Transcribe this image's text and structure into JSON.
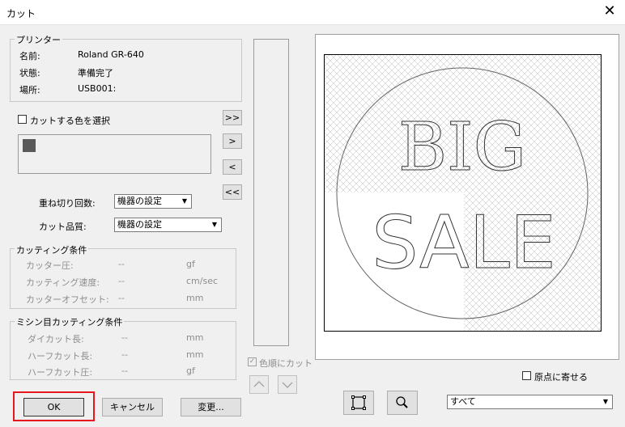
{
  "window": {
    "title": "カット",
    "close": "✕"
  },
  "printer": {
    "legend": "プリンター",
    "rows": [
      {
        "label": "名前:",
        "value": "Roland GR-640"
      },
      {
        "label": "状態:",
        "value": "準備完了"
      },
      {
        "label": "場所:",
        "value": "USB001:"
      }
    ]
  },
  "color_select": {
    "label": "カットする色を選択",
    "checked": false,
    "swatch": "#595959"
  },
  "move_buttons": [
    ">>",
    ">",
    "<",
    "<<"
  ],
  "settings": {
    "passes_label": "重ね切り回数:",
    "passes_value": "機器の設定",
    "quality_label": "カット品質:",
    "quality_value": "機器の設定"
  },
  "cutting": {
    "legend": "カッティング条件",
    "rows": [
      {
        "label": "カッター圧:",
        "value": "--",
        "unit": "gf"
      },
      {
        "label": "カッティング速度:",
        "value": "--",
        "unit": "cm/sec"
      },
      {
        "label": "カッターオフセット:",
        "value": "--",
        "unit": "mm"
      }
    ]
  },
  "perforation": {
    "legend": "ミシン目カッティング条件",
    "rows": [
      {
        "label": "ダイカット長:",
        "value": "--",
        "unit": "mm"
      },
      {
        "label": "ハーフカット長:",
        "value": "--",
        "unit": "mm"
      },
      {
        "label": "ハーフカット圧:",
        "value": "--",
        "unit": "gf"
      }
    ]
  },
  "color_order": {
    "label": "色順にカット",
    "checked": true
  },
  "origin": {
    "label": "原点に寄せる",
    "checked": false
  },
  "preview": {
    "line1": "BIG",
    "line2": "SALE"
  },
  "view_select": {
    "value": "すべて"
  },
  "footer": {
    "ok": "OK",
    "cancel": "キャンセル",
    "change": "変更..."
  }
}
